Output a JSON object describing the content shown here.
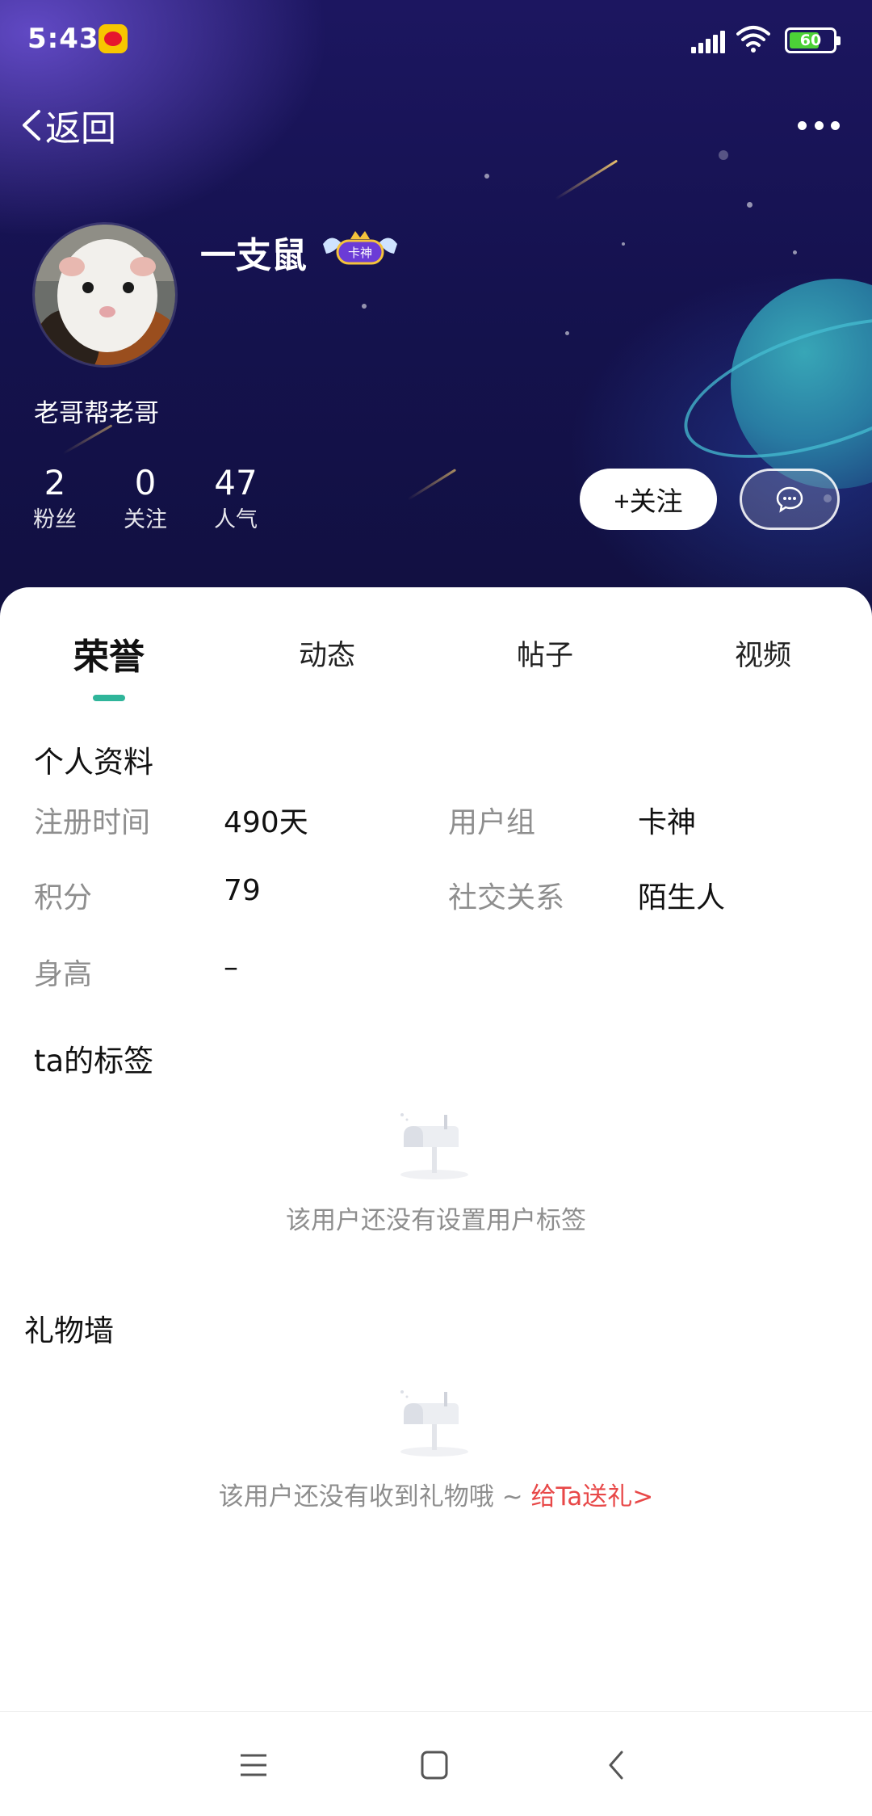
{
  "status_bar": {
    "time": "5:43",
    "battery_percent": "60",
    "icons": [
      "weibo-notification-icon",
      "signal-icon",
      "wifi-icon",
      "battery-icon"
    ]
  },
  "nav": {
    "back_label": "返回",
    "more_icon": "more-dots-icon"
  },
  "profile": {
    "username": "一支鼠",
    "badge_text": "卡神",
    "signature": "老哥帮老哥",
    "stats": [
      {
        "value": "2",
        "label": "粉丝"
      },
      {
        "value": "0",
        "label": "关注"
      },
      {
        "value": "47",
        "label": "人气"
      }
    ],
    "follow_label": "+关注",
    "message_icon": "chat-bubble-icon"
  },
  "tabs": [
    {
      "label": "荣誉",
      "active": true
    },
    {
      "label": "动态",
      "active": false
    },
    {
      "label": "帖子",
      "active": false
    },
    {
      "label": "视频",
      "active": false
    }
  ],
  "personal_info": {
    "title": "个人资料",
    "fields": [
      {
        "label": "注册时间",
        "value": "490天"
      },
      {
        "label": "用户组",
        "value": "卡神"
      },
      {
        "label": "积分",
        "value": "79"
      },
      {
        "label": "社交关系",
        "value": "陌生人"
      },
      {
        "label": "身高",
        "value": "–"
      }
    ]
  },
  "tags_section": {
    "title": "ta的标签",
    "empty_text": "该用户还没有设置用户标签"
  },
  "gift_wall": {
    "title": "礼物墙",
    "empty_text": "该用户还没有收到礼物哦 ~ ",
    "gift_link": "给Ta送礼>"
  },
  "colors": {
    "accent": "#2fb59a",
    "link_red": "#e84848",
    "header_bg": "#15124f"
  },
  "system_nav": [
    "menu-icon",
    "home-square-icon",
    "back-chevron-icon"
  ]
}
